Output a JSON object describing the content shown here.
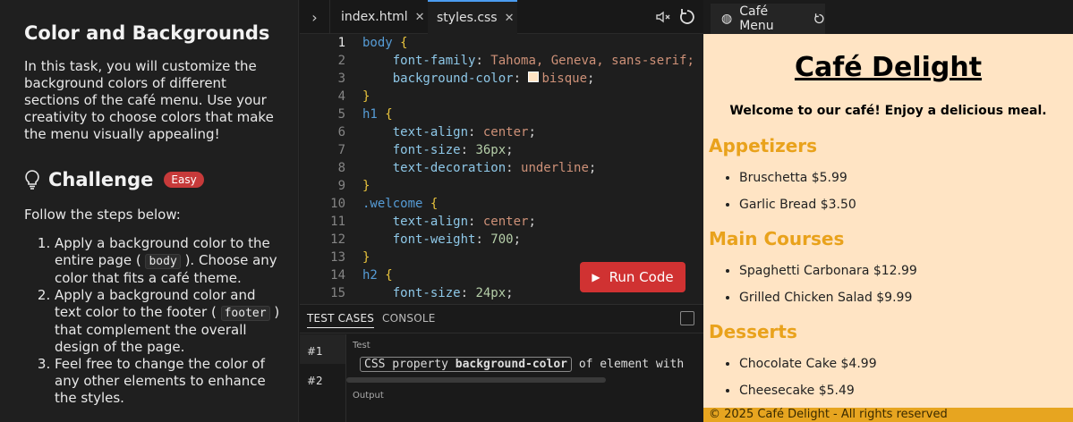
{
  "left": {
    "title": "Color and Backgrounds",
    "intro": "In this task, you will customize the background colors of different sections of the café menu. Use your creativity to choose colors that make the menu visually appealing!",
    "challenge_title": "Challenge",
    "difficulty": "Easy",
    "follow": "Follow the steps below:",
    "step1_a": "Apply a background color to the entire page (",
    "step1_code": "body",
    "step1_b": "). Choose any color that fits a café theme.",
    "step2_a": "Apply a background color and text color to the footer (",
    "step2_code": "footer",
    "step2_b": ") that complement the overall design of the page.",
    "step3": "Feel free to change the color of any other elements to enhance the styles."
  },
  "editor": {
    "tabs": [
      {
        "label": "index.html"
      },
      {
        "label": "styles.css"
      }
    ],
    "run_label": "Run Code",
    "code": {
      "l1_sel": "body",
      "l1_b": "{",
      "l2_p": "font-family",
      "l2_v": "Tahoma, Geneva, sans-serif;",
      "l3_p": "background-color",
      "l3_v": "bisque",
      "l5_sel": "h1",
      "l5_b": "{",
      "l6_p": "text-align",
      "l6_v": "center",
      "l7_p": "font-size",
      "l7_v": "36px",
      "l8_p": "text-decoration",
      "l8_v": "underline",
      "l10_sel": ".welcome",
      "l10_b": "{",
      "l11_p": "text-align",
      "l11_v": "center",
      "l12_p": "font-weight",
      "l12_v": "700",
      "l14_sel": "h2",
      "l14_b": "{",
      "l15_p": "font-size",
      "l15_v": "24px",
      "close": "}"
    },
    "line_numbers": [
      "1",
      "2",
      "3",
      "4",
      "5",
      "6",
      "7",
      "8",
      "9",
      "10",
      "11",
      "12",
      "13",
      "14",
      "15"
    ]
  },
  "tests": {
    "tab_cases": "TEST CASES",
    "tab_console": "CONSOLE",
    "cases": [
      "#1",
      "#2"
    ],
    "label_test": "Test",
    "label_output": "Output",
    "test_a": "CSS property",
    "test_b": "background-color",
    "test_c": "of element with"
  },
  "preview": {
    "tab_label": "Café Menu",
    "heading": "Café Delight",
    "welcome": "Welcome to our café! Enjoy a delicious meal.",
    "sections": [
      {
        "title": "Appetizers",
        "items": [
          "Bruschetta $5.99",
          "Garlic Bread $3.50"
        ]
      },
      {
        "title": "Main Courses",
        "items": [
          "Spaghetti Carbonara $12.99",
          "Grilled Chicken Salad $9.99"
        ]
      },
      {
        "title": "Desserts",
        "items": [
          "Chocolate Cake $4.99",
          "Cheesecake $5.49"
        ]
      }
    ],
    "footer": "© 2025 Café Delight - All rights reserved",
    "bg_color": "#ffe4c4",
    "accent": "#e9a21c"
  }
}
